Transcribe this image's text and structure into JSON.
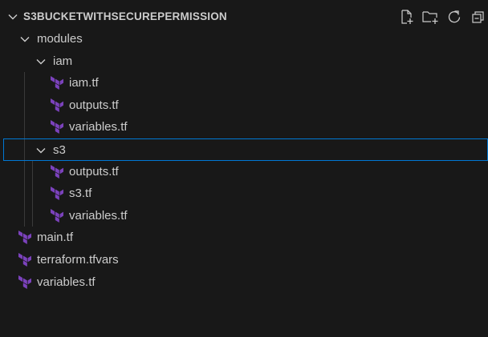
{
  "explorer": {
    "title": "S3BUCKETWITHSECUREPERMISSION",
    "actions": [
      {
        "name": "new-file-icon"
      },
      {
        "name": "new-folder-icon"
      },
      {
        "name": "refresh-icon"
      },
      {
        "name": "collapse-all-icon"
      }
    ]
  },
  "tree": [
    {
      "label": "modules",
      "kind": "folder",
      "expanded": true,
      "depth": 1
    },
    {
      "label": "iam",
      "kind": "folder",
      "expanded": true,
      "depth": 2
    },
    {
      "label": "iam.tf",
      "kind": "terraform-file",
      "depth": 3
    },
    {
      "label": "outputs.tf",
      "kind": "terraform-file",
      "depth": 3
    },
    {
      "label": "variables.tf",
      "kind": "terraform-file",
      "depth": 3
    },
    {
      "label": "s3",
      "kind": "folder",
      "expanded": true,
      "depth": 2,
      "selected": true
    },
    {
      "label": "outputs.tf",
      "kind": "terraform-file",
      "depth": 3
    },
    {
      "label": "s3.tf",
      "kind": "terraform-file",
      "depth": 3
    },
    {
      "label": "variables.tf",
      "kind": "terraform-file",
      "depth": 3
    },
    {
      "label": "main.tf",
      "kind": "terraform-file",
      "depth": 1
    },
    {
      "label": "terraform.tfvars",
      "kind": "terraform-file",
      "depth": 1
    },
    {
      "label": "variables.tf",
      "kind": "terraform-file",
      "depth": 1
    }
  ],
  "colors": {
    "background": "#181818",
    "text": "#cccccc",
    "terraform_icon": "#7b42bc",
    "selection_border": "#0078d4"
  }
}
